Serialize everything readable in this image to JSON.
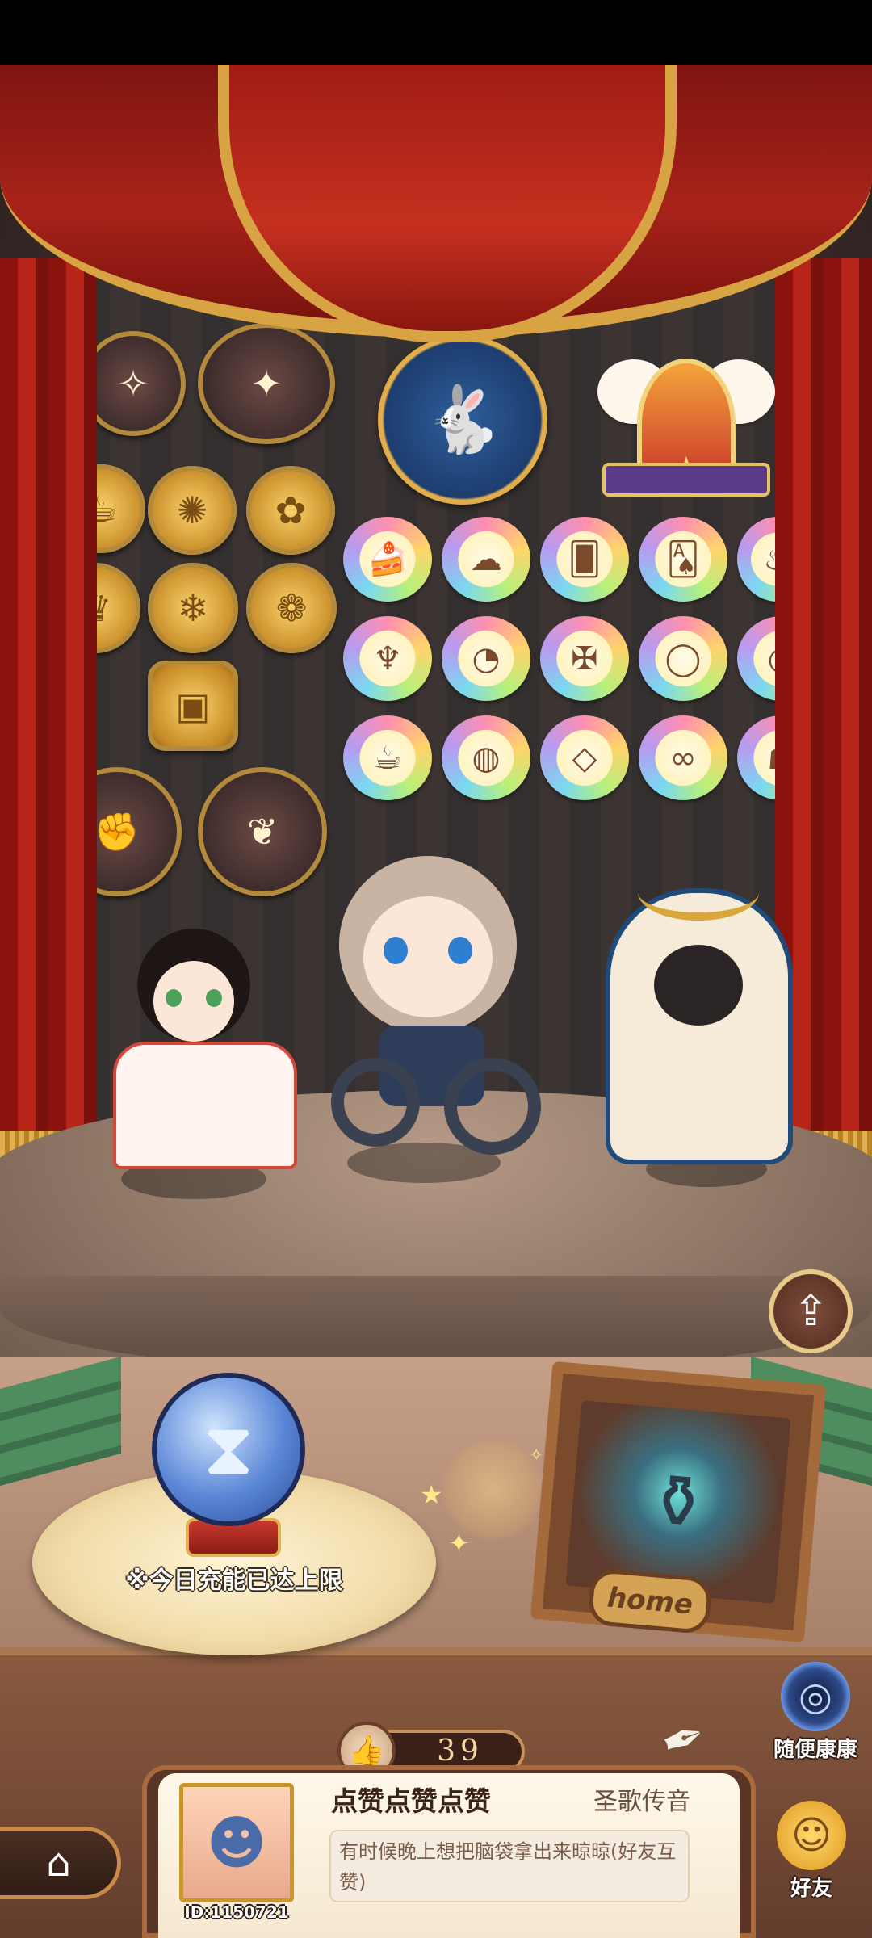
{
  "charge_status": "※今日充能已达上限",
  "home_tag": "home",
  "likes_count": "39",
  "profile": {
    "username": "点赞点赞点赞",
    "guild": "圣歌传音",
    "bio": "有时候晚上想把脑袋拿出来晾晾(好友互赞)",
    "user_id": "ID:1150721"
  },
  "side_buttons": {
    "random_visit": "随便康康",
    "friends": "好友"
  },
  "icons": {
    "share": "share-icon",
    "home": "home-icon",
    "hourglass": "hourglass-icon",
    "thumbs_up": "thumbs-up-icon",
    "portal": "portal-icon",
    "friends": "friends-icon"
  },
  "colors": {
    "curtain_red": "#a8231a",
    "gold_trim": "#d8a342",
    "orb_blue": "#5a86d6"
  }
}
